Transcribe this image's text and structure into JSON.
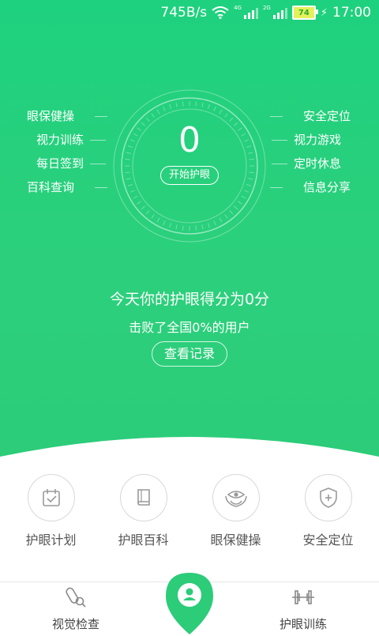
{
  "status_bar": {
    "speed": "745B/s",
    "net1": "4G",
    "net2": "2G",
    "battery": "74",
    "time": "17:00"
  },
  "left_menu": [
    "眼保健操",
    "视力训练",
    "每日签到",
    "百科查询"
  ],
  "right_menu": [
    "安全定位",
    "视力游戏",
    "定时休息",
    "信息分享"
  ],
  "dial": {
    "score": "0",
    "start_label": "开始护眼"
  },
  "summary": {
    "line1": "今天你的护眼得分为0分",
    "line2": "击败了全国0%的用户",
    "record_label": "查看记录"
  },
  "tools": [
    {
      "label": "护眼计划",
      "icon": "calendar-check-icon"
    },
    {
      "label": "护眼百科",
      "icon": "book-icon"
    },
    {
      "label": "眼保健操",
      "icon": "hands-eye-icon"
    },
    {
      "label": "安全定位",
      "icon": "shield-plus-icon"
    }
  ],
  "bottom_nav": {
    "left": "视觉检查",
    "right": "护眼训练",
    "center_icon": "user-pin-icon"
  },
  "colors": {
    "primary": "#2ccc79"
  }
}
